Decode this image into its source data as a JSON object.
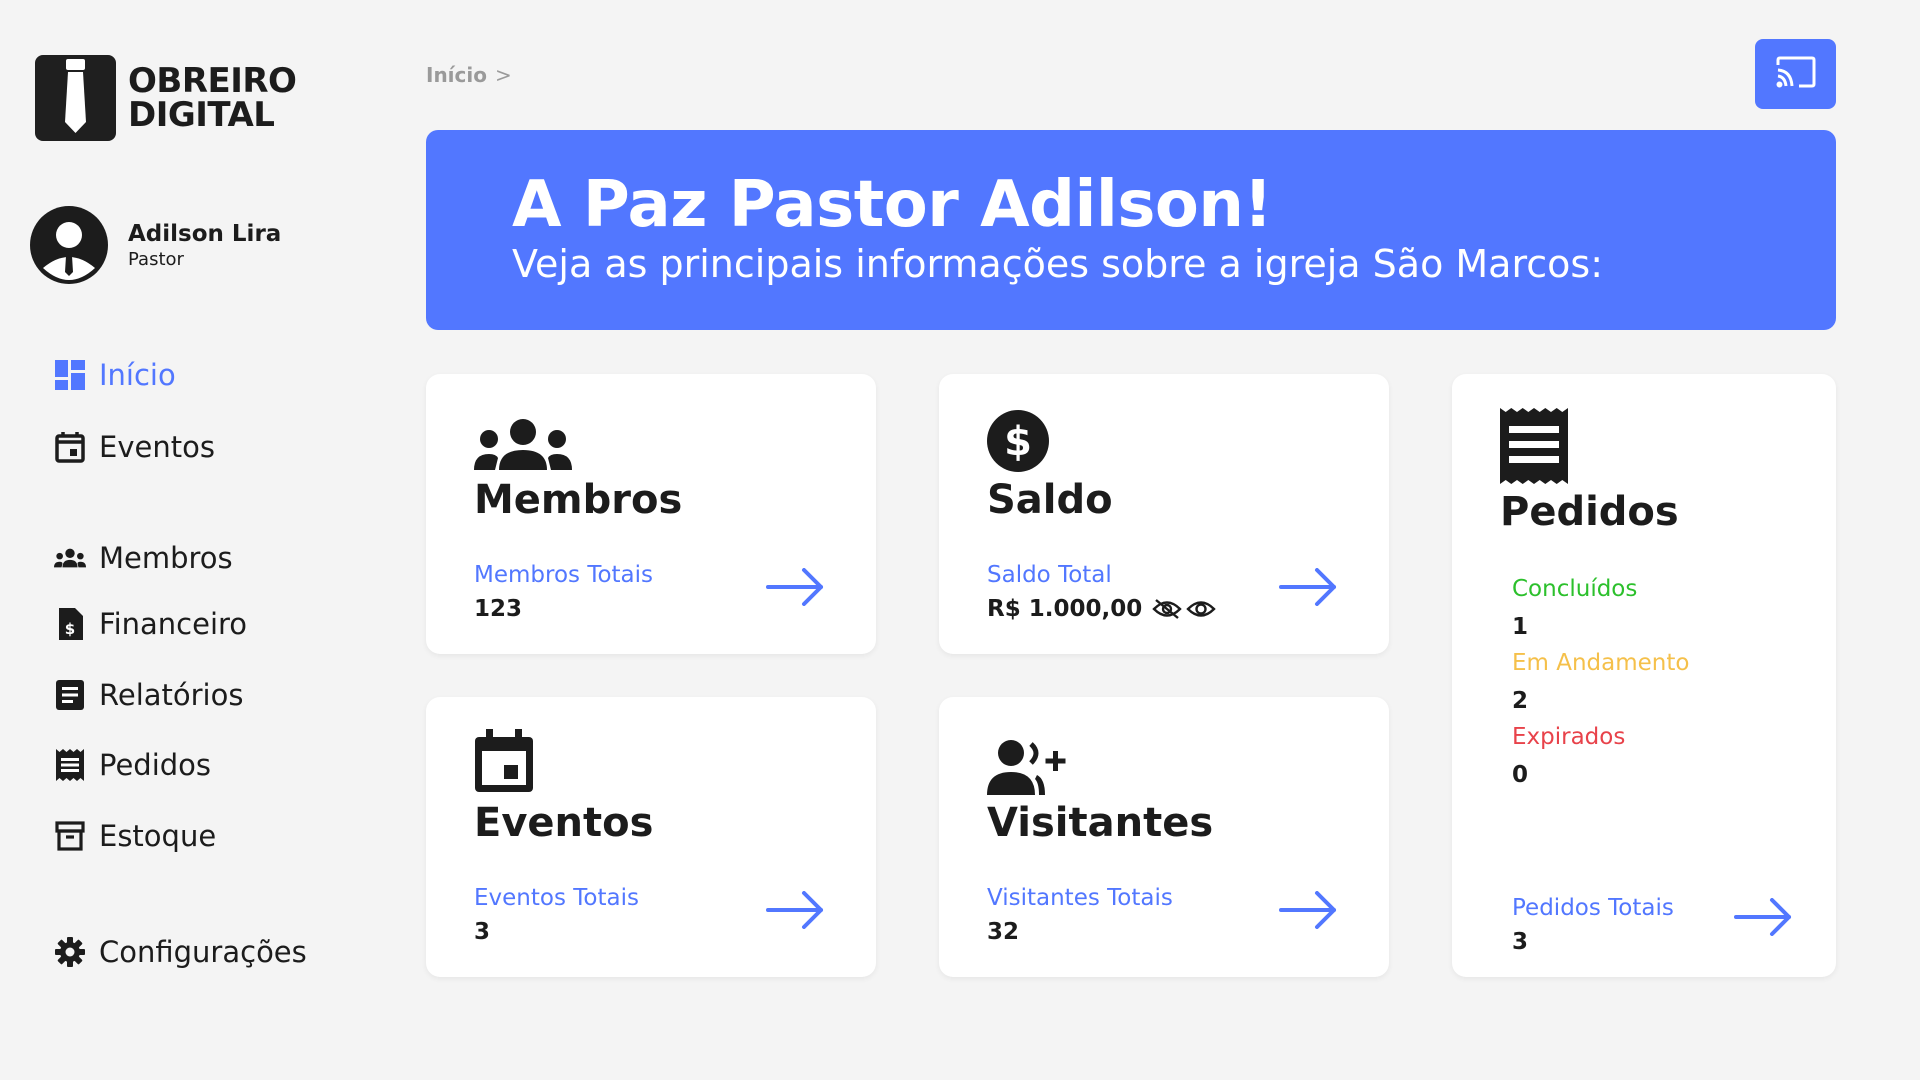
{
  "brand": {
    "line1": "OBREIRO",
    "line2": "DIGITAL"
  },
  "user": {
    "name": "Adilson Lira",
    "role": "Pastor"
  },
  "nav": {
    "inicio": "Início",
    "eventos": "Eventos",
    "membros": "Membros",
    "financeiro": "Financeiro",
    "relatorios": "Relatórios",
    "pedidos": "Pedidos",
    "estoque": "Estoque",
    "configuracoes": "Configurações"
  },
  "breadcrumb": {
    "current": "Início",
    "separator": ">"
  },
  "banner": {
    "title": "A Paz Pastor Adilson!",
    "subtitle": "Veja as principais informações sobre a igreja São Marcos:"
  },
  "cards": {
    "membros": {
      "title": "Membros",
      "label": "Membros Totais",
      "value": "123",
      "icon": "group-icon"
    },
    "saldo": {
      "title": "Saldo",
      "label": "Saldo Total",
      "value": "R$ 1.000,00",
      "icon": "dollar-icon"
    },
    "eventos": {
      "title": "Eventos",
      "label": "Eventos Totais",
      "value": "3",
      "icon": "calendar-icon"
    },
    "visitantes": {
      "title": "Visitantes",
      "label": "Visitantes Totais",
      "value": "32",
      "icon": "person-add-icon"
    },
    "pedidos": {
      "title": "Pedidos",
      "concluidos_label": "Concluídos",
      "concluidos_value": "1",
      "andamento_label": "Em Andamento",
      "andamento_value": "2",
      "expirados_label": "Expirados",
      "expirados_value": "0",
      "label": "Pedidos Totais",
      "value": "3",
      "icon": "receipt-icon"
    }
  },
  "colors": {
    "accent": "#5277ff",
    "background": "#f4f4f4",
    "text": "#1c1c1c",
    "concluidos": "#2cc02c",
    "andamento": "#f5c04a",
    "expirados": "#e8424a"
  }
}
